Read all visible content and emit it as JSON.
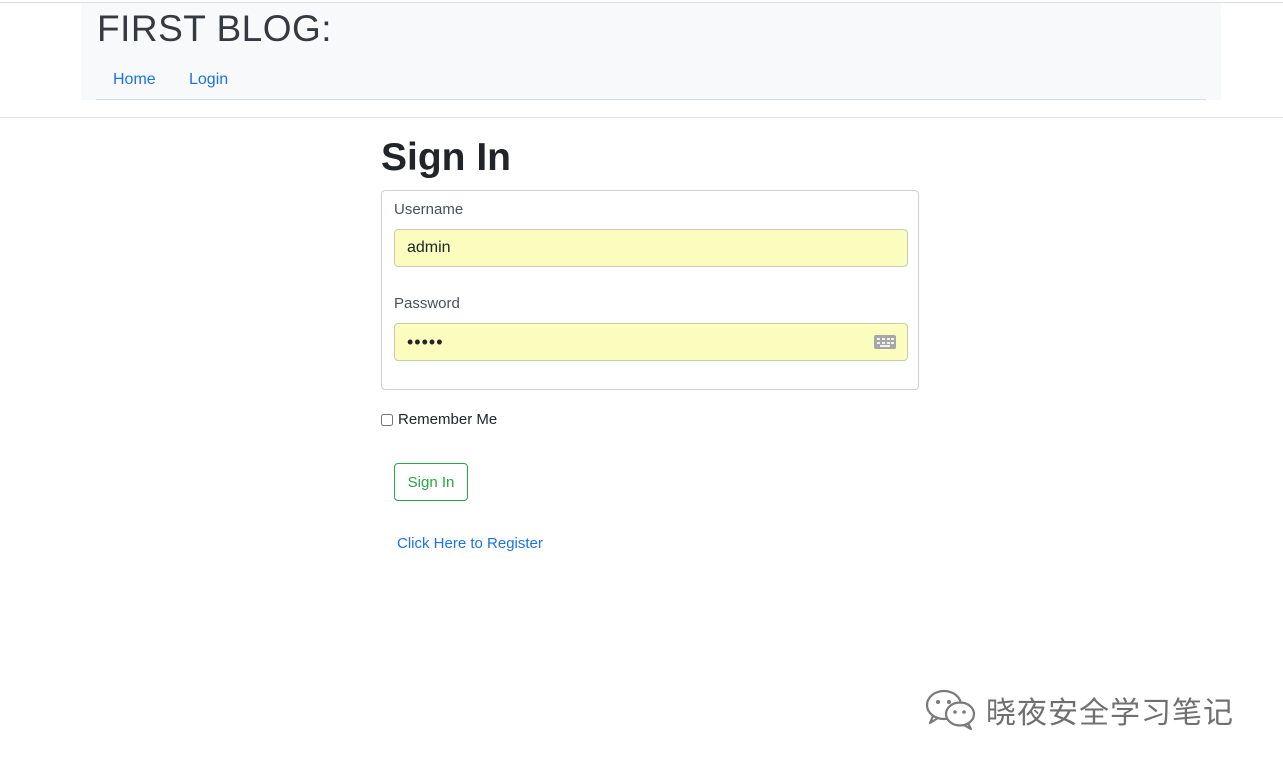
{
  "header": {
    "brand": "FIRST BLOG:",
    "nav": [
      {
        "label": "Home"
      },
      {
        "label": "Login"
      }
    ]
  },
  "form": {
    "title": "Sign In",
    "username_label": "Username",
    "username_value": "admin",
    "password_label": "Password",
    "password_value": "•••••",
    "remember_label": "Remember Me",
    "remember_checked": false,
    "submit_label": "Sign In",
    "register_link": "Click Here to Register"
  },
  "watermark": {
    "text": "晓夜安全学习笔记",
    "icon": "wechat-icon"
  },
  "colors": {
    "link": "#1a73e8",
    "button_success": "#28a745",
    "autofill_bg": "#fafdbe"
  }
}
